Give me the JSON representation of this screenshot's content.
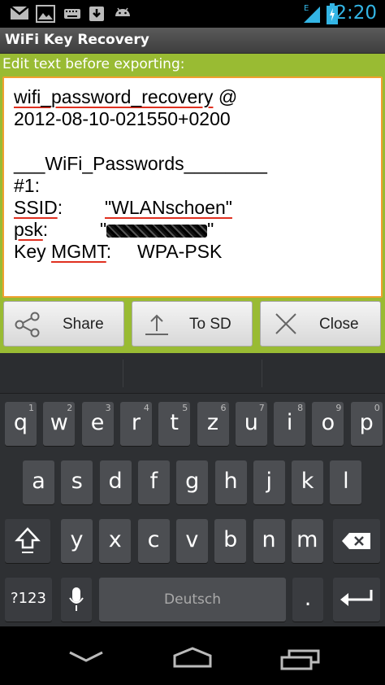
{
  "status_bar": {
    "time": "2:20",
    "network_type": "E",
    "icons": [
      "gmail-icon",
      "gallery-icon",
      "keyboard-icon",
      "download-icon",
      "android-icon",
      "signal-icon",
      "battery-charging-icon"
    ]
  },
  "app": {
    "title": "WiFi Key Recovery"
  },
  "dialog": {
    "label": "Edit text before exporting:",
    "text": {
      "line1_word": "wifi_password_recovery",
      "line1_rest": " @",
      "line2": "2012-08-10-021550+0200",
      "line3": "___WiFi_Passwords________",
      "line4": "#1:",
      "ssid_label": "SSID",
      "ssid_colon": ":",
      "ssid_value": "\"WLANschoen\"",
      "psk_label": "psk",
      "psk_colon": ":",
      "psk_quote_open": "\"",
      "psk_quote_close": "\"",
      "mgmt_key": "Key ",
      "mgmt_word": "MGMT",
      "mgmt_colon": ":",
      "mgmt_value": "WPA-PSK"
    },
    "buttons": {
      "share": "Share",
      "to_sd": "To SD",
      "close": "Close"
    }
  },
  "keyboard": {
    "row1": [
      {
        "k": "q",
        "h": "1"
      },
      {
        "k": "w",
        "h": "2"
      },
      {
        "k": "e",
        "h": "3"
      },
      {
        "k": "r",
        "h": "4"
      },
      {
        "k": "t",
        "h": "5"
      },
      {
        "k": "z",
        "h": "6"
      },
      {
        "k": "u",
        "h": "7"
      },
      {
        "k": "i",
        "h": "8"
      },
      {
        "k": "o",
        "h": "9"
      },
      {
        "k": "p",
        "h": "0"
      }
    ],
    "row2": [
      "a",
      "s",
      "d",
      "f",
      "g",
      "h",
      "j",
      "k",
      "l"
    ],
    "row3": [
      "y",
      "x",
      "c",
      "v",
      "b",
      "n",
      "m"
    ],
    "symbols_label": "?123",
    "space_label": "Deutsch",
    "period_label": "."
  },
  "nav": {
    "icons": [
      "back-icon",
      "home-icon",
      "recent-apps-icon"
    ]
  },
  "colors": {
    "accent_green": "#99bb33",
    "clock_blue": "#33b5e5",
    "focus_orange": "#f0a030",
    "spell_red": "#e03020"
  }
}
